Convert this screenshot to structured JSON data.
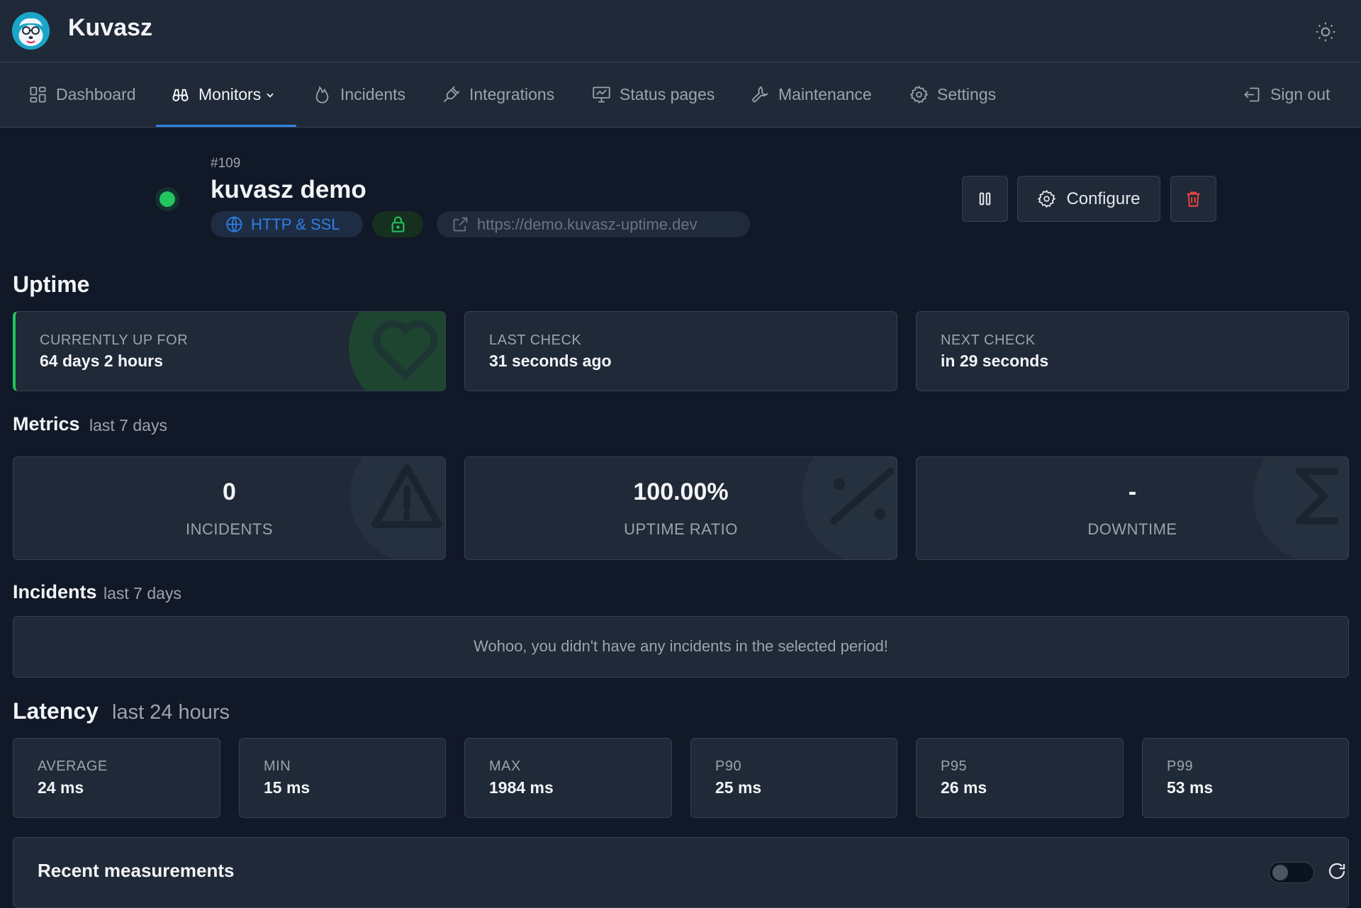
{
  "app": {
    "title": "Kuvasz"
  },
  "header": {
    "theme_toggle_icon": "sun-icon"
  },
  "nav": {
    "items": [
      {
        "label": "Dashboard",
        "icon": "dashboard-icon"
      },
      {
        "label": "Monitors",
        "icon": "binoculars-icon",
        "active": true
      },
      {
        "label": "Incidents",
        "icon": "flame-icon"
      },
      {
        "label": "Integrations",
        "icon": "plug-icon"
      },
      {
        "label": "Status pages",
        "icon": "presentation-icon"
      },
      {
        "label": "Maintenance",
        "icon": "wrench-icon"
      },
      {
        "label": "Settings",
        "icon": "gear-icon"
      }
    ],
    "sign_out": "Sign out"
  },
  "monitor": {
    "id": "#109",
    "name": "kuvasz demo",
    "type": "HTTP & SSL",
    "url": "https://demo.kuvasz-uptime.dev",
    "status_color": "#22c55e",
    "actions": {
      "configure": "Configure"
    }
  },
  "uptime": {
    "title": "Uptime",
    "cards": [
      {
        "label": "CURRENTLY UP FOR",
        "value": "64 days 2 hours"
      },
      {
        "label": "LAST CHECK",
        "value": "31 seconds ago"
      },
      {
        "label": "NEXT CHECK",
        "value": "in 29 seconds"
      }
    ]
  },
  "metrics": {
    "title": "Metrics",
    "subtitle": "last 7 days",
    "cards": [
      {
        "value": "0",
        "label": "INCIDENTS"
      },
      {
        "value": "100.00%",
        "label": "UPTIME RATIO"
      },
      {
        "value": "-",
        "label": "DOWNTIME"
      }
    ]
  },
  "incidents": {
    "title": "Incidents",
    "subtitle": "last 7 days",
    "empty_message": "Wohoo, you didn't have any incidents in the selected period!"
  },
  "latency": {
    "title": "Latency",
    "subtitle": "last 24 hours",
    "cards": [
      {
        "label": "AVERAGE",
        "value": "24 ms"
      },
      {
        "label": "MIN",
        "value": "15 ms"
      },
      {
        "label": "MAX",
        "value": "1984 ms"
      },
      {
        "label": "P90",
        "value": "25 ms"
      },
      {
        "label": "P95",
        "value": "26 ms"
      },
      {
        "label": "P99",
        "value": "53 ms"
      }
    ]
  },
  "recent": {
    "title": "Recent measurements"
  },
  "colors": {
    "accent": "#2f7fe6",
    "success": "#22c55e",
    "danger": "#ef4444"
  }
}
